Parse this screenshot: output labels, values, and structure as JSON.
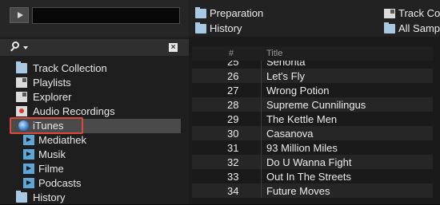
{
  "favorites": [
    {
      "label": "Preparation",
      "icon": "folder-icon"
    },
    {
      "label": "History",
      "icon": "folder-icon"
    },
    {
      "label": "Track Co",
      "icon": "list-icon"
    },
    {
      "label": "All Samp",
      "icon": "folder-icon"
    }
  ],
  "search": {
    "placeholder": "",
    "clear_glyph": "×"
  },
  "tree": [
    {
      "label": "Track Collection",
      "icon": "folder-icon"
    },
    {
      "label": "Playlists",
      "icon": "playlist-icon"
    },
    {
      "label": "Explorer",
      "icon": "explorer-icon"
    },
    {
      "label": "Audio Recordings",
      "icon": "audio-recordings-icon"
    },
    {
      "label": "iTunes",
      "icon": "itunes-icon"
    },
    {
      "label": "Mediathek",
      "icon": "play-icon"
    },
    {
      "label": "Musik",
      "icon": "play-icon"
    },
    {
      "label": "Filme",
      "icon": "play-icon"
    },
    {
      "label": "Podcasts",
      "icon": "play-icon"
    },
    {
      "label": "History",
      "icon": "folder-icon"
    }
  ],
  "table": {
    "headers": {
      "num": "#",
      "title": "Title"
    },
    "rows": [
      {
        "num": "25",
        "title": "Senorita"
      },
      {
        "num": "26",
        "title": "Let's Fly"
      },
      {
        "num": "27",
        "title": "Wrong Potion"
      },
      {
        "num": "28",
        "title": "Supreme Cunnilingus"
      },
      {
        "num": "29",
        "title": "The Kettle Men"
      },
      {
        "num": "30",
        "title": "Casanova"
      },
      {
        "num": "31",
        "title": "93 Million Miles"
      },
      {
        "num": "32",
        "title": "Do U Wanna Fight"
      },
      {
        "num": "33",
        "title": "Out In The Streets"
      },
      {
        "num": "34",
        "title": "Future Moves"
      }
    ]
  },
  "colors": {
    "highlight": "#d84a3a",
    "folder": "#a9c8e2"
  }
}
